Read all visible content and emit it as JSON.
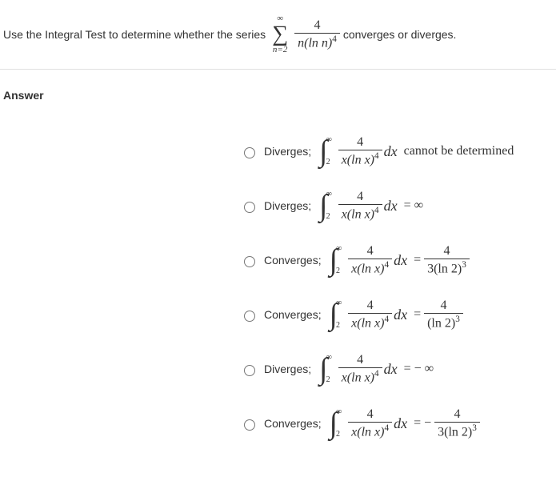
{
  "question": {
    "lead": "Use the Integral Test to determine whether the series",
    "sigma_top": "∞",
    "sigma_bottom": "n=2",
    "frac_num": "4",
    "frac_den_base": "n(ln n)",
    "frac_den_exp": "4",
    "tail": "converges or diverges."
  },
  "answer_label": "Answer",
  "integral": {
    "symbol": "∫",
    "upper": "∞",
    "lower": "2",
    "frac_num": "4",
    "frac_den_base": "x(ln x)",
    "frac_den_exp": "4",
    "dx": "dx"
  },
  "options": [
    {
      "result": "Diverges;",
      "tail_type": "text",
      "tail_text": " cannot be determined"
    },
    {
      "result": "Diverges;",
      "tail_type": "eq_inf",
      "eq": " = ∞"
    },
    {
      "result": "Converges;",
      "tail_type": "eq_frac",
      "eq": " =",
      "rhs_num": "4",
      "rhs_den": "3(ln 2)",
      "rhs_den_exp": "3",
      "neg": ""
    },
    {
      "result": "Converges;",
      "tail_type": "eq_frac",
      "eq": " =",
      "rhs_num": "4",
      "rhs_den": "(ln 2)",
      "rhs_den_exp": "3",
      "neg": ""
    },
    {
      "result": "Diverges;",
      "tail_type": "eq_inf",
      "eq": " = − ∞"
    },
    {
      "result": "Converges;",
      "tail_type": "eq_frac",
      "eq": " =",
      "rhs_num": "4",
      "rhs_den": "3(ln 2)",
      "rhs_den_exp": "3",
      "neg": " − "
    }
  ]
}
